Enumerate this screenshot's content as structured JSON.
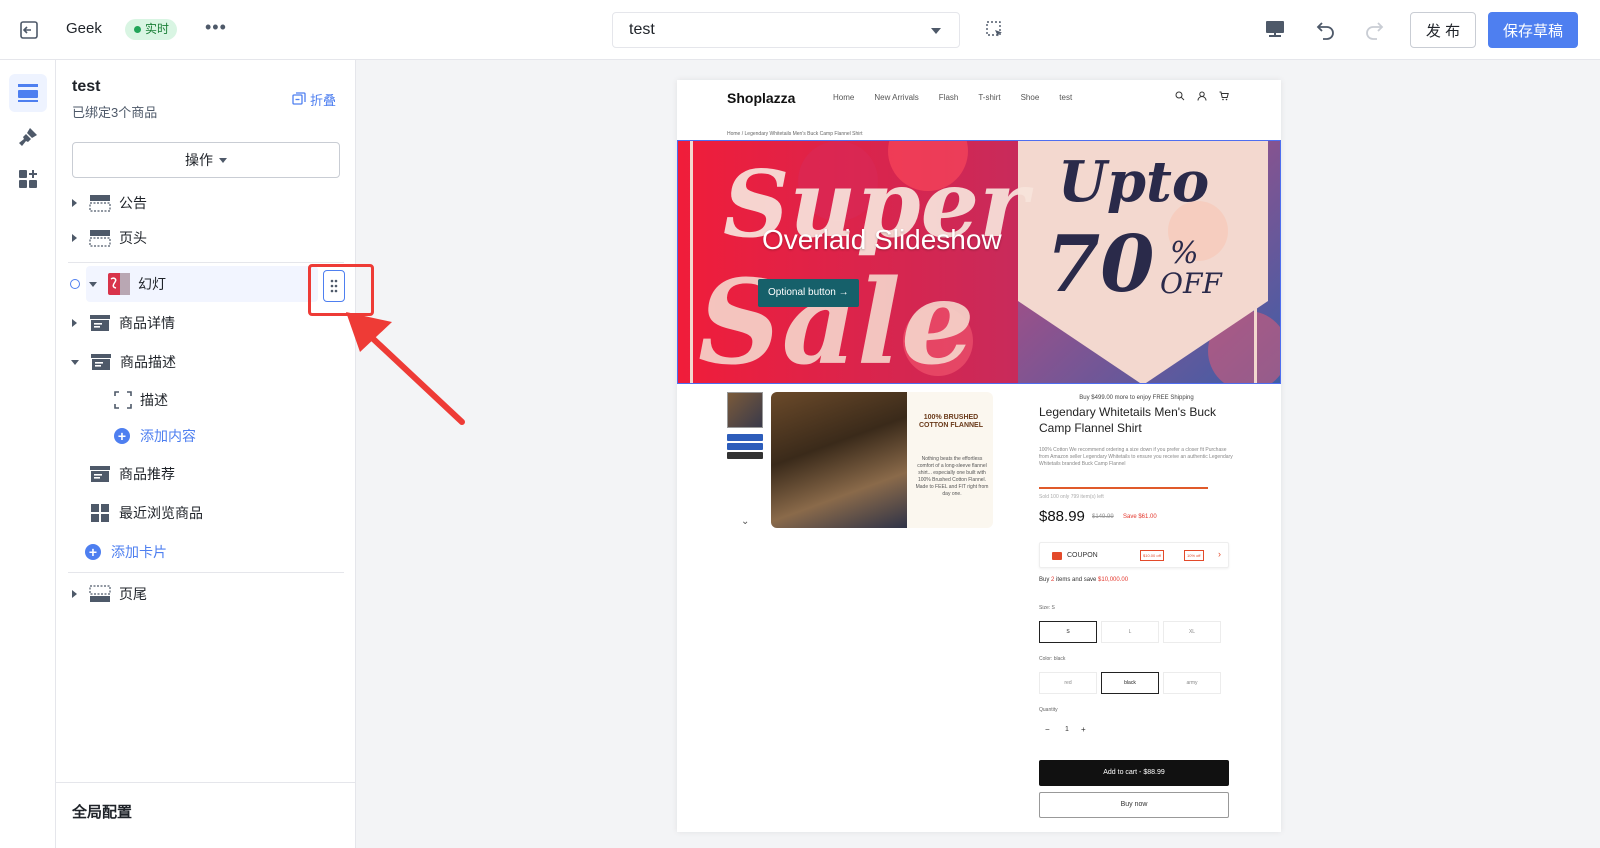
{
  "topbar": {
    "store_name": "Geek",
    "status_badge": "实时",
    "more": "•••",
    "page_select": "test",
    "publish_label": "发 布",
    "save_draft_label": "保存草稿"
  },
  "panel": {
    "title": "test",
    "subtitle": "已绑定3个商品",
    "fold_label": "折叠",
    "operations_label": "操作",
    "tree": {
      "announcement": "公告",
      "header": "页头",
      "slideshow": "幻灯",
      "product_detail": "商品详情",
      "product_description": "商品描述",
      "description": "描述",
      "add_content": "添加内容",
      "product_recommend": "商品推荐",
      "recently_viewed": "最近浏览商品",
      "add_card": "添加卡片",
      "footer": "页尾"
    },
    "global_config": "全局配置"
  },
  "preview": {
    "logo": "Shoplazza",
    "nav": [
      "Home",
      "New Arrivals",
      "Flash",
      "T-shirt",
      "Shoe",
      "test"
    ],
    "breadcrumb": "Home / Legendary Whitetails Men's Buck Camp Flannel Shirt",
    "banner": {
      "title": "Overlaid Slideshow",
      "button": "Optional button →",
      "art_super": "Super",
      "art_sale": "Sale",
      "art_upto": "Upto",
      "art_70": "70",
      "art_percent": "%",
      "art_off": "OFF"
    },
    "product_image": {
      "headline": "100% BRUSHED COTTON FLANNEL",
      "body": "Nothing beats the effortless comfort of a long-sleeve flannel shirt... especially one built with 100% Brushed Cotton Flannel. Made to FEEL and FIT right from day one."
    },
    "thumb_chevron": "⌄",
    "product": {
      "shipping_note": "Buy $499.00 more to enjoy FREE Shipping",
      "title": "Legendary Whitetails Men's Buck Camp Flannel Shirt",
      "description": "100% Cotton We recommend ordering a size down if you prefer a closer fit Purchase from Amazon seller Legendary Whitetails to ensure you receive an authentic Legendary Whitetails branded Buck Camp Flannel",
      "stock": "Sold 100 only 799 item(s) left",
      "stock_fraction": 0.89,
      "price": "$88.99",
      "old_price": "$149.99",
      "save": "Save $61.00",
      "coupon_label": "COUPON",
      "coupon_tag_1": "$10.00 off",
      "coupon_tag_2": "10% off",
      "coupon_chevron": "›",
      "bulk_pre": "Buy ",
      "bulk_qty": "2",
      "bulk_mid": " items and save ",
      "bulk_amount": "$10,000.00",
      "size_label": "Size:  S",
      "sizes": [
        "S",
        "L",
        "XL"
      ],
      "color_label": "Color:  black",
      "colors": [
        "red",
        "black",
        "army"
      ],
      "quantity_label": "Quantity",
      "qty_minus": "−",
      "quantity": "1",
      "qty_plus": "+",
      "add_to_cart": "Add to cart - $88.99",
      "buy_now": "Buy now"
    }
  },
  "colors": {
    "accent": "#4e7ff0",
    "highlight": "#ee3b36",
    "live_green": "#22a559"
  }
}
